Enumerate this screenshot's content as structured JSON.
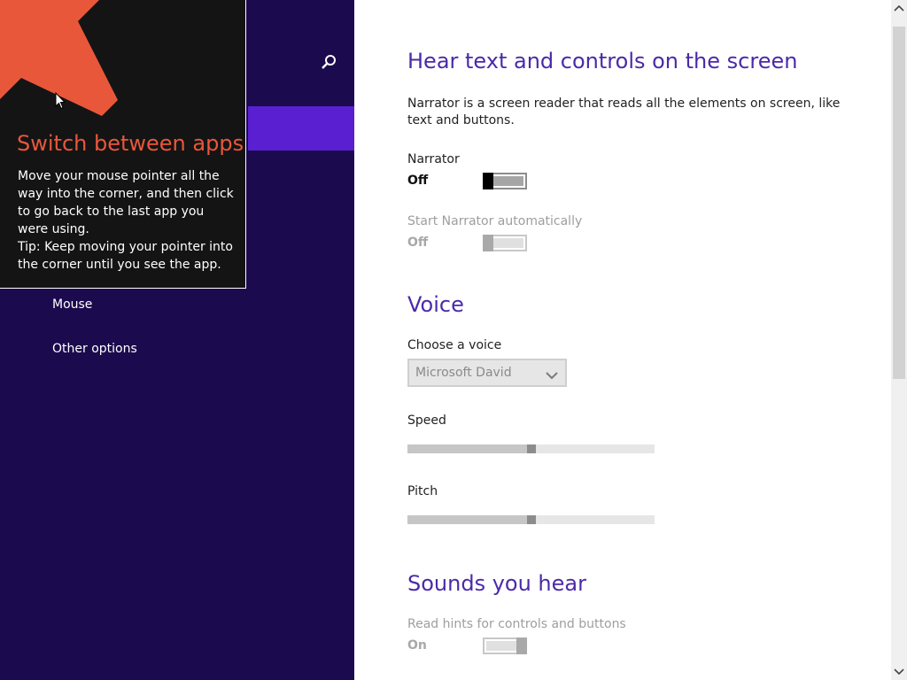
{
  "nav": {
    "search_icon": "search-icon",
    "items": [
      {
        "label": "Mouse"
      },
      {
        "label": "Other options"
      }
    ],
    "colors": {
      "background": "#1b0a4d",
      "selected": "#5a1fd1"
    }
  },
  "tip": {
    "title": "Switch between apps",
    "body": "Move your mouse pointer all the way into the corner, and then click to go back to the last app you were using.",
    "tip_text": "Tip: Keep moving your pointer into the corner until you see the app.",
    "arrow_icon": "arrow-up-left-icon",
    "colors": {
      "title": "#e9573b",
      "arrow": "#e9573b"
    }
  },
  "narrator_section": {
    "heading": "Hear text and controls on the screen",
    "description": "Narrator is a screen reader that reads all the elements on screen, like text and buttons.",
    "narrator": {
      "label": "Narrator",
      "state": "Off"
    },
    "auto_start": {
      "label": "Start Narrator automatically",
      "state": "Off"
    }
  },
  "voice_section": {
    "heading": "Voice",
    "choose_voice_label": "Choose a voice",
    "selected_voice": "Microsoft David",
    "speed": {
      "label": "Speed",
      "value": 0.5
    },
    "pitch": {
      "label": "Pitch",
      "value": 0.5
    }
  },
  "sounds_section": {
    "heading": "Sounds you hear",
    "read_hints": {
      "label": "Read hints for controls and buttons",
      "state": "On"
    }
  },
  "colors": {
    "heading": "#4b2aa8"
  }
}
